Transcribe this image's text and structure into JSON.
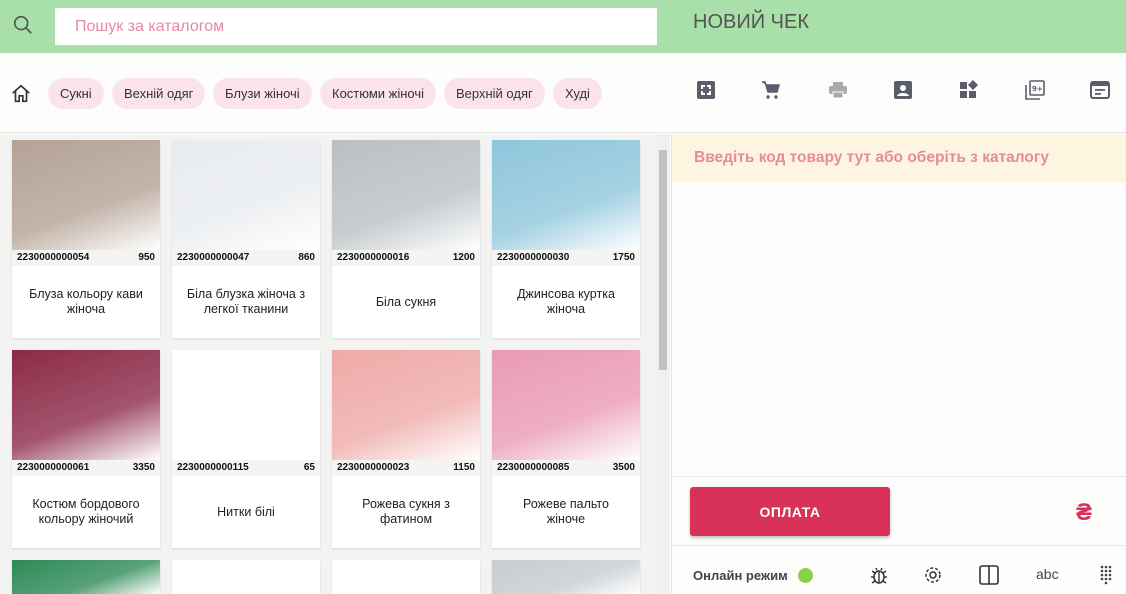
{
  "header": {
    "search_placeholder": "Пошук за каталогом",
    "title": "НОВИЙ ЧЕК"
  },
  "categories": [
    "Сукні",
    "Вехній одяг",
    "Блузи жіночі",
    "Костюми жіночі",
    "Верхній одяг",
    "Худі"
  ],
  "toolbar_icons": [
    "fullscreen-icon",
    "cart-icon",
    "print-icon",
    "contact-icon",
    "widgets-icon",
    "filter-9-plus-icon",
    "receipt-icon"
  ],
  "products": [
    {
      "code": "2230000000054",
      "price": "950",
      "name": "Блуза кольору кави жіноча",
      "color": "#b4a295"
    },
    {
      "code": "2230000000047",
      "price": "860",
      "name": "Біла блузка жіноча з легкої тканини",
      "color": "#e9ecef"
    },
    {
      "code": "2230000000016",
      "price": "1200",
      "name": "Біла сукня",
      "color": "#b9c0c4"
    },
    {
      "code": "2230000000030",
      "price": "1750",
      "name": "Джинсова куртка жіноча",
      "color": "#8fc6dc"
    },
    {
      "code": "2230000000061",
      "price": "3350",
      "name": "Костюм бордового кольору жіночий",
      "color": "#8c2a48"
    },
    {
      "code": "2230000000115",
      "price": "65",
      "name": "Нитки білі",
      "color": "#ffffff"
    },
    {
      "code": "2230000000023",
      "price": "1150",
      "name": "Рожева сукня з фатином",
      "color": "#eeaaa8"
    },
    {
      "code": "2230000000085",
      "price": "3500",
      "name": "Рожеве пальто жіноче",
      "color": "#e99ab5"
    },
    {
      "code": "",
      "price": "",
      "name": "",
      "color": "#2e8a57"
    },
    {
      "code": "",
      "price": "",
      "name": "",
      "color": "#ffffff"
    },
    {
      "code": "",
      "price": "",
      "name": "",
      "color": "#ffffff"
    },
    {
      "code": "",
      "price": "",
      "name": "",
      "color": "#c7ccd0"
    }
  ],
  "receipt": {
    "banner": "Введіть код товару тут або оберіть з каталогу",
    "pay_label": "ОПЛАТА",
    "currency": "₴"
  },
  "footer": {
    "status": "Онлайн режим",
    "abc": "abc"
  },
  "colors": {
    "header": "#a9dfa8",
    "accent": "#d9325a",
    "online": "#8bcf4a"
  }
}
